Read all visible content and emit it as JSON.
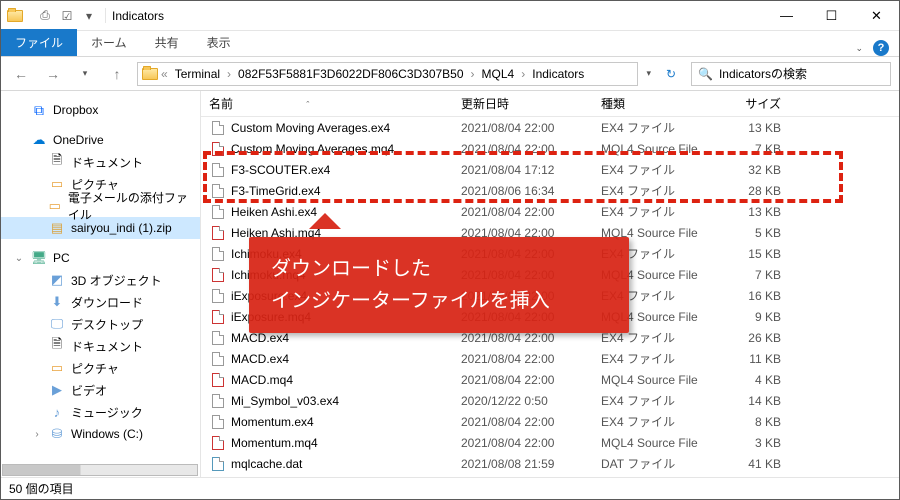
{
  "window": {
    "title": "Indicators"
  },
  "sys": {
    "min": "—",
    "max": "☐",
    "close": "✕"
  },
  "qa": {
    "i1": "⎙",
    "i2": "☑",
    "i3": "▾"
  },
  "ribbon": {
    "file": "ファイル",
    "home": "ホーム",
    "share": "共有",
    "view": "表示",
    "expand": "⌄"
  },
  "nav": {
    "back": "←",
    "fwd": "→",
    "down": "▾",
    "up": "↑",
    "refresh": "↻",
    "addr_drop": "▾"
  },
  "breadcrumb": {
    "sep": "›",
    "lead": "«",
    "items": [
      "Terminal",
      "082F53F5881F3D6022DF806C3D307B50",
      "MQL4",
      "Indicators"
    ]
  },
  "search": {
    "icon": "🔍",
    "placeholder": "Indicatorsの検索"
  },
  "tree": {
    "items": [
      {
        "exp": "",
        "icon": "⧉",
        "cls": "dropbox",
        "label": "Dropbox",
        "deep": false
      },
      {
        "exp": "",
        "icon": "☁",
        "cls": "onedrive",
        "label": "OneDrive",
        "deep": false
      },
      {
        "exp": "",
        "icon": "🗎",
        "cls": "",
        "label": "ドキュメント",
        "deep": true
      },
      {
        "exp": "",
        "icon": "▭",
        "cls": "yel",
        "label": "ピクチャ",
        "deep": true
      },
      {
        "exp": "",
        "icon": "▭",
        "cls": "yel",
        "label": "電子メールの添付ファイル",
        "deep": true
      },
      {
        "exp": "",
        "icon": "▤",
        "cls": "zip",
        "label": "sairyou_indi (1).zip",
        "deep": true,
        "sel": true
      },
      {
        "exp": "⌄",
        "icon": "🖥",
        "cls": "pc",
        "label": "PC",
        "deep": false
      },
      {
        "exp": "",
        "icon": "◩",
        "cls": "drive",
        "label": "3D オブジェクト",
        "deep": true
      },
      {
        "exp": "",
        "icon": "⬇",
        "cls": "drive",
        "label": "ダウンロード",
        "deep": true
      },
      {
        "exp": "",
        "icon": "🖵",
        "cls": "drive",
        "label": "デスクトップ",
        "deep": true
      },
      {
        "exp": "",
        "icon": "🗎",
        "cls": "",
        "label": "ドキュメント",
        "deep": true
      },
      {
        "exp": "",
        "icon": "▭",
        "cls": "yel",
        "label": "ピクチャ",
        "deep": true
      },
      {
        "exp": "",
        "icon": "▶",
        "cls": "drive",
        "label": "ビデオ",
        "deep": true
      },
      {
        "exp": "",
        "icon": "♪",
        "cls": "drive",
        "label": "ミュージック",
        "deep": true
      },
      {
        "exp": "›",
        "icon": "⛁",
        "cls": "drive",
        "label": "Windows (C:)",
        "deep": true
      }
    ]
  },
  "columns": {
    "name": "名前",
    "date": "更新日時",
    "type": "種類",
    "size": "サイズ",
    "sort": "ˆ"
  },
  "files": [
    {
      "ic": "ex4",
      "name": "Custom Moving Averages.ex4",
      "date": "2021/08/04 22:00",
      "type": "EX4 ファイル",
      "size": "13 KB"
    },
    {
      "ic": "mq4",
      "name": "Custom Moving Averages.mq4",
      "date": "2021/08/04 22:00",
      "type": "MQL4 Source File",
      "size": "7 KB"
    },
    {
      "ic": "ex4",
      "name": "F3-SCOUTER.ex4",
      "date": "2021/08/04 17:12",
      "type": "EX4 ファイル",
      "size": "32 KB"
    },
    {
      "ic": "ex4",
      "name": "F3-TimeGrid.ex4",
      "date": "2021/08/06 16:34",
      "type": "EX4 ファイル",
      "size": "28 KB"
    },
    {
      "ic": "ex4",
      "name": "Heiken Ashi.ex4",
      "date": "2021/08/04 22:00",
      "type": "EX4 ファイル",
      "size": "13 KB"
    },
    {
      "ic": "mq4",
      "name": "Heiken Ashi.mq4",
      "date": "2021/08/04 22:00",
      "type": "MQL4 Source File",
      "size": "5 KB"
    },
    {
      "ic": "ex4",
      "name": "Ichimoku.ex4",
      "date": "2021/08/04 22:00",
      "type": "EX4 ファイル",
      "size": "15 KB"
    },
    {
      "ic": "mq4",
      "name": "Ichimoku.mq4",
      "date": "2021/08/04 22:00",
      "type": "MQL4 Source File",
      "size": "7 KB"
    },
    {
      "ic": "ex4",
      "name": "iExposure.ex4",
      "date": "2021/08/04 22:00",
      "type": "EX4 ファイル",
      "size": "16 KB"
    },
    {
      "ic": "mq4",
      "name": "iExposure.mq4",
      "date": "2021/08/04 22:00",
      "type": "MQL4 Source File",
      "size": "9 KB"
    },
    {
      "ic": "ex4",
      "name": "MACD.ex4",
      "date": "2021/08/04 22:00",
      "type": "EX4 ファイル",
      "size": "26 KB"
    },
    {
      "ic": "ex4",
      "name": "MACD.ex4",
      "date": "2021/08/04 22:00",
      "type": "EX4 ファイル",
      "size": "11 KB"
    },
    {
      "ic": "mq4",
      "name": "MACD.mq4",
      "date": "2021/08/04 22:00",
      "type": "MQL4 Source File",
      "size": "4 KB"
    },
    {
      "ic": "ex4",
      "name": "Mi_Symbol_v03.ex4",
      "date": "2020/12/22 0:50",
      "type": "EX4 ファイル",
      "size": "14 KB"
    },
    {
      "ic": "ex4",
      "name": "Momentum.ex4",
      "date": "2021/08/04 22:00",
      "type": "EX4 ファイル",
      "size": "8 KB"
    },
    {
      "ic": "mq4",
      "name": "Momentum.mq4",
      "date": "2021/08/04 22:00",
      "type": "MQL4 Source File",
      "size": "3 KB"
    },
    {
      "ic": "dat",
      "name": "mqlcache.dat",
      "date": "2021/08/08 21:59",
      "type": "DAT ファイル",
      "size": "41 KB"
    }
  ],
  "status": {
    "count": "50 個の項目"
  },
  "callout": {
    "line1": "ダウンロードした",
    "line2": "インジケーターファイルを挿入"
  }
}
